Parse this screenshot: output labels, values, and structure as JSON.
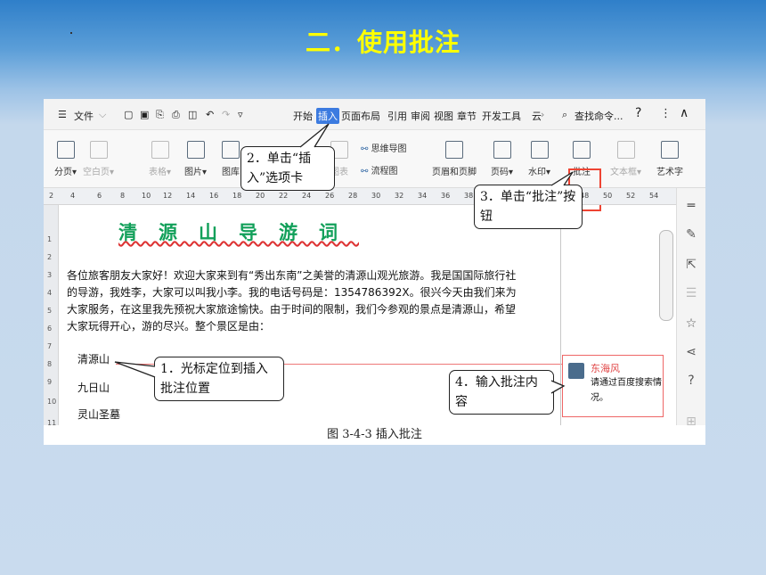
{
  "slide": {
    "title": "二．使用批注"
  },
  "titlebar": {
    "menu_file": "文件",
    "tabs": [
      "开始",
      "插入",
      "页面布局",
      "引用",
      "审阅",
      "视图",
      "章节",
      "开发工具",
      "云"
    ],
    "search": "查找命令...",
    "help": "?",
    "more": "⋮",
    "collapse": "∧"
  },
  "ribbon": {
    "items": [
      {
        "label": "分页",
        "dim": false
      },
      {
        "label": "空白页",
        "dim": true
      },
      {
        "label": "表格",
        "dim": true
      },
      {
        "label": "图片",
        "dim": false
      },
      {
        "label": "图库",
        "dim": false
      },
      {
        "label": "图表",
        "dim": true
      },
      {
        "label": "页眉和页脚",
        "dim": false
      },
      {
        "label": "页码",
        "dim": false
      },
      {
        "label": "水印",
        "dim": false
      },
      {
        "label": "批注",
        "dim": false
      },
      {
        "label": "文本框",
        "dim": true
      },
      {
        "label": "艺术字",
        "dim": false
      }
    ],
    "mindmap": "思维导图",
    "flowchart": "流程图"
  },
  "ruler": {
    "ticks": [
      "2",
      "4",
      "6",
      "8",
      "10",
      "12",
      "14",
      "16",
      "18",
      "20",
      "22",
      "24",
      "26",
      "28",
      "30",
      "32",
      "34",
      "36",
      "38",
      "40",
      "42",
      "44",
      "46",
      "48",
      "50",
      "52",
      "54"
    ]
  },
  "vruler": {
    "ticks": [
      "1",
      "2",
      "3",
      "4",
      "5",
      "6",
      "7",
      "8",
      "9",
      "10",
      "11"
    ]
  },
  "document": {
    "title": "清源山导游词",
    "para1": "各位旅客朋友大家好！欢迎大家来到有“秀出东南”之美誉的清源山观光旅游。我是国国际旅行社的导游，我姓李，大家可以叫我小李。我的电话号码是：1354786392X。很兴今天由我们来为大家服务，在这里我先预祝大家旅途愉快。由于时间的限制，我们今参观的景点是清源山，希望大家玩得开心，游的尽兴。整个景区是由：",
    "lines": [
      "清源山",
      "九日山",
      "灵山圣墓"
    ]
  },
  "comment": {
    "author": "东海风",
    "text": "请通过百度搜索情况。"
  },
  "callouts": {
    "c1": "1．光标定位到插入批注位置",
    "c2": "2．单击“插入”选项卡",
    "c3": "3．单击“批注”按钮",
    "c4": "4．输入批注内容"
  },
  "caption": "图 3-4-3 插入批注"
}
